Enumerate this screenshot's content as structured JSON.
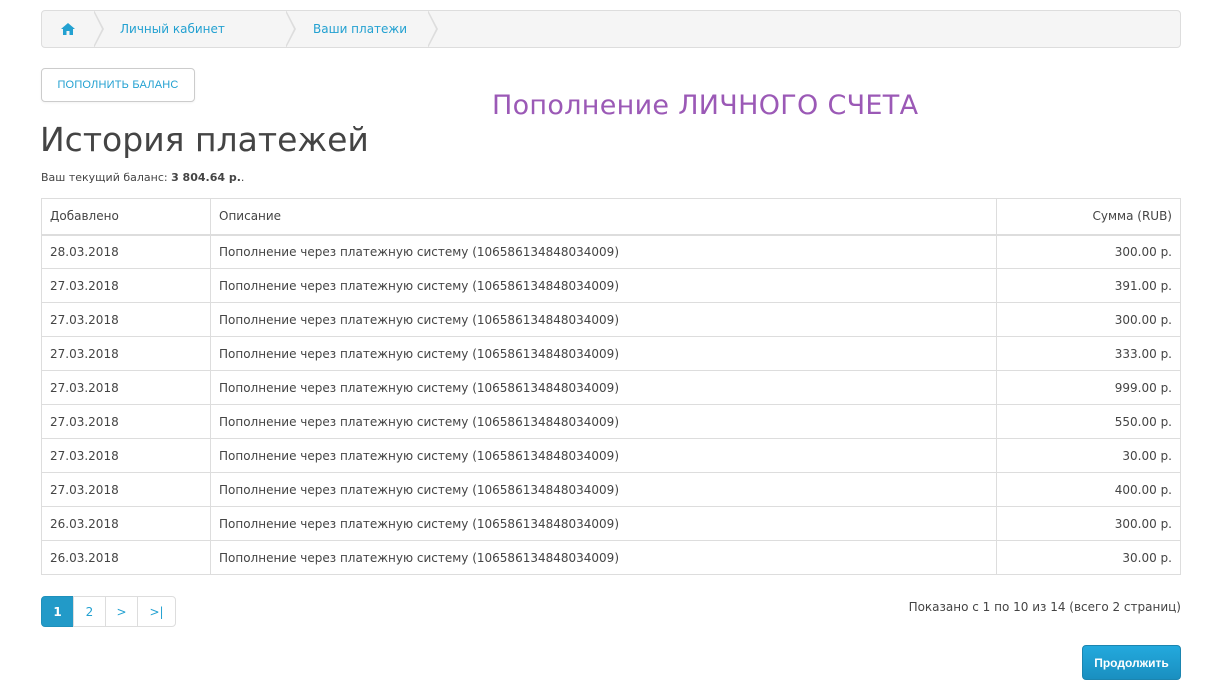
{
  "breadcrumb": {
    "home_icon": "home-icon",
    "items": [
      "Личный кабинет",
      "Ваши платежи"
    ]
  },
  "actions": {
    "topup_label": "ПОПОЛНИТЬ БАЛАНС",
    "continue_label": "Продолжить"
  },
  "overlay_caption": "Пополнение ЛИЧНОГО СЧЕТА",
  "page": {
    "title": "История платежей",
    "balance_label": "Ваш текущий баланс:",
    "balance_value": "3 804.64 р.",
    "balance_suffix": "."
  },
  "table": {
    "headers": [
      "Добавлено",
      "Описание",
      "Сумма (RUB)"
    ],
    "rows": [
      [
        "28.03.2018",
        "Пополнение через платежную систему (106586134848034009)",
        "300.00 р."
      ],
      [
        "27.03.2018",
        "Пополнение через платежную систему (106586134848034009)",
        "391.00 р."
      ],
      [
        "27.03.2018",
        "Пополнение через платежную систему (106586134848034009)",
        "300.00 р."
      ],
      [
        "27.03.2018",
        "Пополнение через платежную систему (106586134848034009)",
        "333.00 р."
      ],
      [
        "27.03.2018",
        "Пополнение через платежную систему (106586134848034009)",
        "999.00 р."
      ],
      [
        "27.03.2018",
        "Пополнение через платежную систему (106586134848034009)",
        "550.00 р."
      ],
      [
        "27.03.2018",
        "Пополнение через платежную систему (106586134848034009)",
        "30.00 р."
      ],
      [
        "27.03.2018",
        "Пополнение через платежную систему (106586134848034009)",
        "400.00 р."
      ],
      [
        "26.03.2018",
        "Пополнение через платежную систему (106586134848034009)",
        "300.00 р."
      ],
      [
        "26.03.2018",
        "Пополнение через платежную систему (106586134848034009)",
        "30.00 р."
      ]
    ]
  },
  "pagination": {
    "pages": [
      "1",
      "2",
      ">",
      ">|"
    ],
    "active": "1",
    "info": "Показано с 1 по 10 из 14 (всего 2 страниц)"
  },
  "colors": {
    "link": "#23a1d1",
    "accent_button": "#229ac8",
    "caption": "#9b59b6"
  }
}
